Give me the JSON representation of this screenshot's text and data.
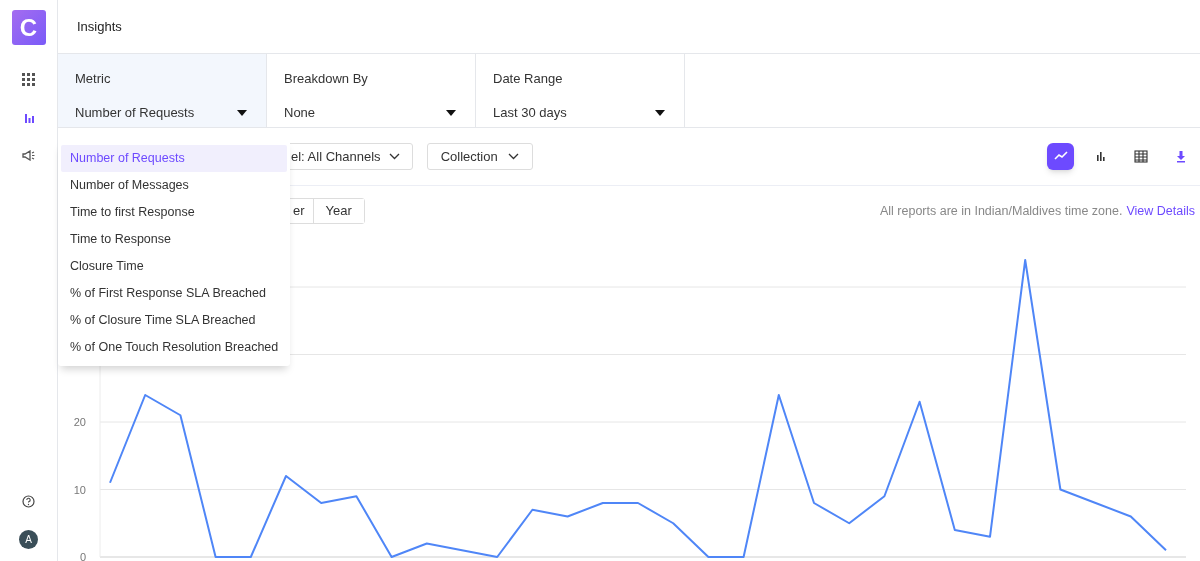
{
  "sidebar": {
    "logo": "C",
    "items": [
      {
        "kind": "grid",
        "selected": false
      },
      {
        "kind": "bars",
        "selected": true
      },
      {
        "kind": "megaphone",
        "selected": false
      }
    ],
    "bottom": {
      "avatar": "A"
    }
  },
  "header": {
    "title": "Insights"
  },
  "filters": [
    {
      "label": "Metric",
      "value": "Number of Requests",
      "selected": true
    },
    {
      "label": "Breakdown By",
      "value": "None",
      "selected": false
    },
    {
      "label": "Date Range",
      "value": "Last 30 days",
      "selected": false
    }
  ],
  "toolbar": {
    "dropdowns": [
      "el: All Channels",
      "Collection"
    ],
    "views": [
      {
        "kind": "line",
        "selected": true
      },
      {
        "kind": "bar",
        "selected": false
      },
      {
        "kind": "table",
        "selected": false
      },
      {
        "kind": "download",
        "selected": false
      }
    ]
  },
  "periods": [
    {
      "label": "er",
      "selected": false
    },
    {
      "label": "Year",
      "selected": false
    }
  ],
  "timezone_note": {
    "text": "All reports are in Indian/Maldives time zone.",
    "link": "View Details"
  },
  "chart_data": {
    "type": "line",
    "ylim": [
      0,
      46
    ],
    "yticks": [
      0,
      10,
      20
    ],
    "series": [
      {
        "color": "#4f86f7",
        "values": [
          11,
          24,
          21,
          0,
          0,
          12,
          8,
          9,
          0,
          2,
          1,
          0,
          7,
          6,
          8,
          8,
          5,
          0,
          0,
          24,
          8,
          5,
          9,
          23,
          4,
          3,
          44,
          10,
          8,
          6,
          1
        ]
      }
    ]
  },
  "metric_menu": [
    {
      "label": "Number of Requests",
      "selected": true
    },
    {
      "label": "Number of Messages",
      "selected": false
    },
    {
      "label": "Time to first Response",
      "selected": false
    },
    {
      "label": "Time to Response",
      "selected": false
    },
    {
      "label": "Closure Time",
      "selected": false
    },
    {
      "label": "% of First Response SLA Breached",
      "selected": false
    },
    {
      "label": "% of Closure Time SLA Breached",
      "selected": false
    },
    {
      "label": "% of One Touch Resolution Breached",
      "selected": false
    }
  ]
}
